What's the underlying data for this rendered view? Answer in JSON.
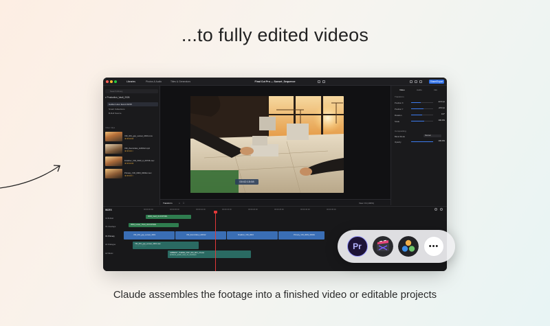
{
  "headline": "...to fully edited videos",
  "caption": "Claude assembles the footage into a finished video or editable projects",
  "window": {
    "tabs": [
      "Libraries",
      "Photos & Audio",
      "Titles & Generators"
    ],
    "title": "Final Cut Pro — Sunset_Sequence",
    "export_label": "Share/Export"
  },
  "library": {
    "search_placeholder": "Search library",
    "project": "Production_Vault_2026",
    "events": [
      "Golden Hour Event 03/15",
      "Smart Collections",
      "B-Roll Source"
    ],
    "section_label": "Video Clips",
    "clips": [
      {
        "name": "VID_001_gsp_sunset_4K01.mov",
        "stars": "★★★★★"
      },
      {
        "name": "VID_Zoomrides_HJ0012.mp4",
        "stars": "★★★★☆"
      },
      {
        "name": "Finalizer_VID_0043_A_09736.mov",
        "stars": "★★★★★"
      },
      {
        "name": "Primary_VID_0003_0004H.mov",
        "stars": "★★★★☆"
      }
    ]
  },
  "viewer": {
    "timecode": "00:02:15:08",
    "tool_label": "Transform",
    "zoom_label": "View: Fit (100%)"
  },
  "inspector": {
    "tabs": [
      "Video",
      "Audio",
      "Info"
    ],
    "section_transform": "Transform",
    "rows": [
      {
        "label": "Position X",
        "value": "-12.0 px",
        "fill": 0.45
      },
      {
        "label": "Position Y",
        "value": "+8.0 px",
        "fill": 0.55
      },
      {
        "label": "Rotation",
        "value": "0.0°",
        "fill": 0.5
      },
      {
        "label": "Scale",
        "value": "100.0%",
        "fill": 0.6
      }
    ],
    "section_compositing": "Compositing",
    "blend_label": "Blend Mode",
    "blend_value": "Normal",
    "opacity_label": "Opacity",
    "opacity_value": "100.0%",
    "opacity_fill": 1.0
  },
  "timeline": {
    "label": "INDEX",
    "ruler": [
      "00:00:00:00",
      "00:00:05:00",
      "00:00:10:00",
      "00:00:15:00",
      "00:00:20:00",
      "00:00:25:00",
      "00:00:30:00",
      "00:00:35:00"
    ],
    "tracks": [
      "V2 B-Roll",
      "V1 Overlays",
      "V1 Primary",
      "A1 Dialogue",
      "A2 Music"
    ],
    "clips": {
      "title_1": "0003_Card_01.FCPXML",
      "title_2": "0004_Lower_Third_04.FCPXML",
      "primary": [
        "VID_001_gsp_sunset_4K01",
        "VID_Zoomrides_HJ0012",
        "Finalizer_VID_0043",
        "Primary_VID_0003_0004H"
      ],
      "dialogue": "VID_001_gsp_sunset_4K01.wav",
      "dialogue_sub": "◦ ◦ ◦ ◦ ◦ ◦ ◦ ◦ ◦ ◦",
      "music": "AMBIENT_THEME_DSP_004_MIX_v3.wav",
      "music_sub": "ambient_audio_bed_v3_mixdown"
    }
  },
  "dock": {
    "apps": [
      "premiere-pro",
      "final-cut-pro",
      "davinci-resolve",
      "more"
    ],
    "premiere_text": "Pr",
    "more_text": "•••"
  }
}
